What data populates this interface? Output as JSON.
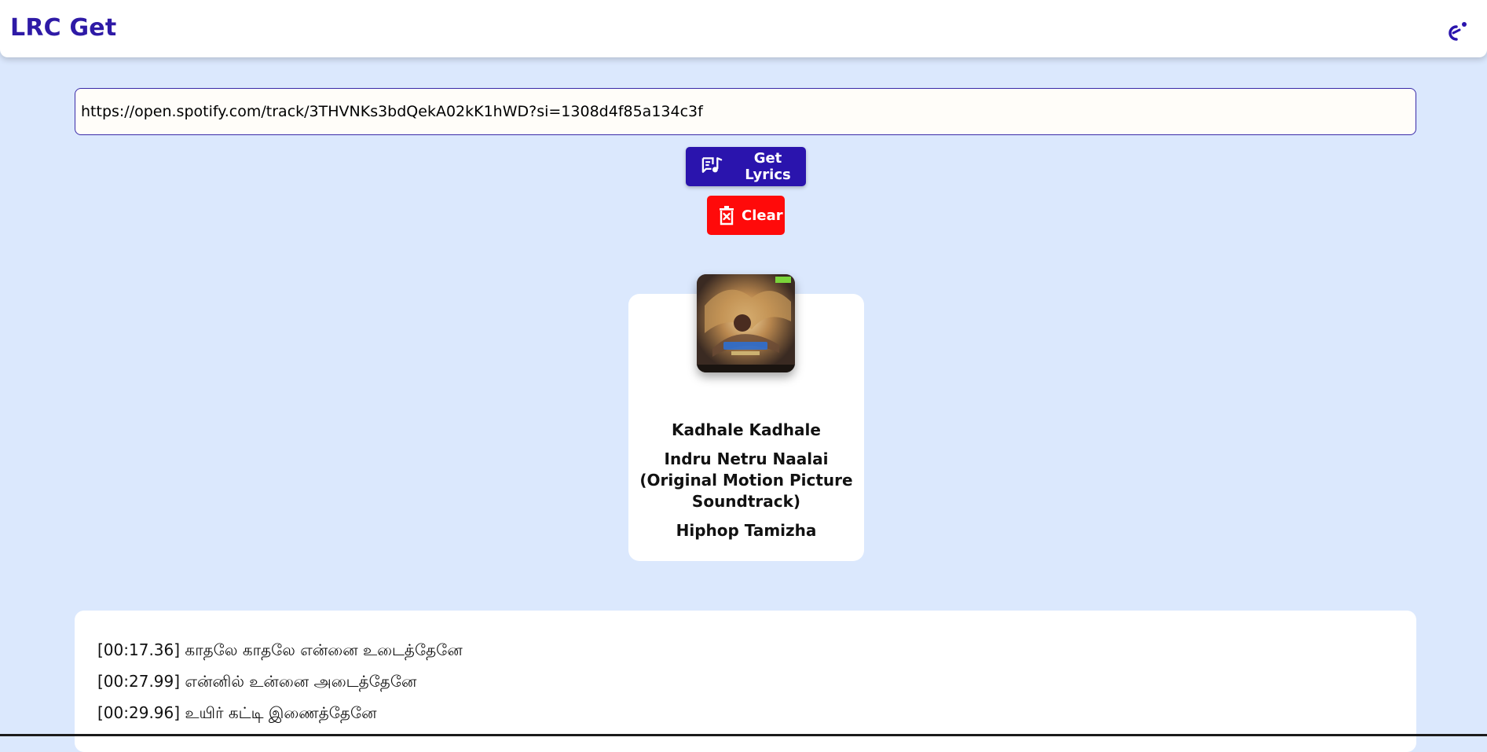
{
  "header": {
    "app_title": "LRC Get",
    "theme_toggle_icon": "theme-toggle-icon"
  },
  "search": {
    "url_value": "https://open.spotify.com/track/3THVNKs3bdQekA02kK1hWD?si=1308d4f85a134c3f"
  },
  "actions": {
    "get_lyrics_label": "Get Lyrics",
    "get_lyrics_icon": "lyrics-note-icon",
    "clear_label": "Clear",
    "clear_icon": "delete-icon"
  },
  "track": {
    "title": "Kadhale Kadhale",
    "album": "Indru Netru Naalai (Original Motion Picture Soundtrack)",
    "artist": "Hiphop Tamizha"
  },
  "lyrics": [
    "[00:17.36] காதலே காதலே என்னை உடைத்தேனே",
    "[00:27.99] என்னில் உன்னை அடைத்தேனே",
    "[00:29.96] உயிர் கட்டி இணைத்தேனே"
  ],
  "colors": {
    "accent": "#2a14ad",
    "danger": "#ff0a0a",
    "page_bg": "#dbe8fd",
    "title_text": "#2e1aa6"
  }
}
